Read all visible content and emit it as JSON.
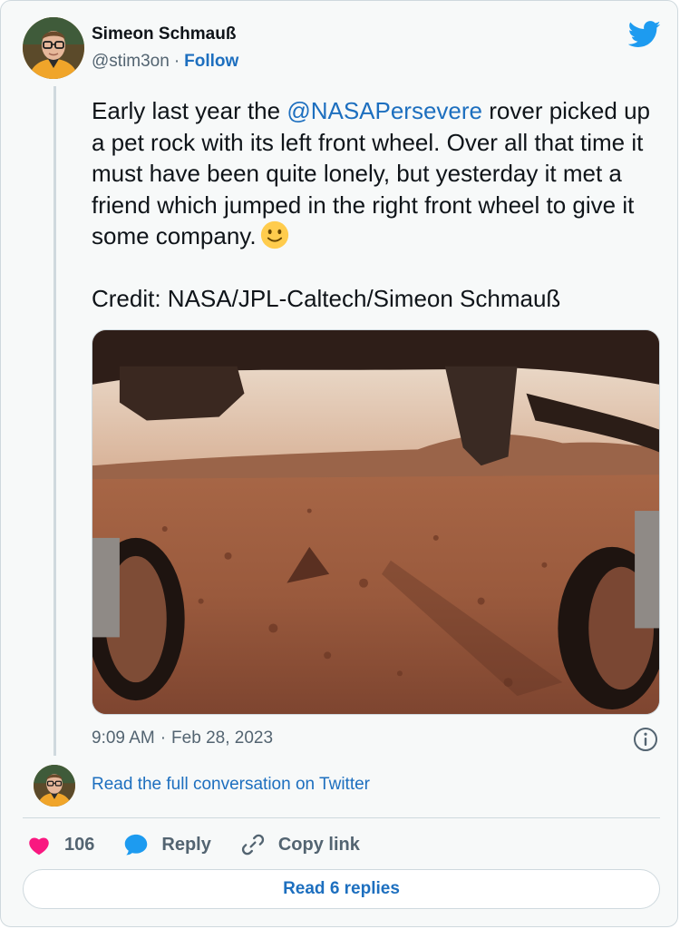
{
  "author": {
    "display_name": "Simeon Schmauß",
    "handle": "@stim3on",
    "separator": "·",
    "follow_label": "Follow"
  },
  "tweet": {
    "text_before_mention": "Early last year the ",
    "mention": "@NASAPersevere",
    "text_after_mention": " rover picked up a pet rock with its left front wheel. Over all that time it must have been quite lonely, but yesterday it met a friend which jumped in the right front wheel to give it some company.",
    "emoji": "slightly-smiling-face",
    "credit": "Credit: NASA/JPL-Caltech/Simeon Schmauß"
  },
  "meta": {
    "time": "9:09 AM",
    "separator": "·",
    "date": "Feb 28, 2023"
  },
  "conversation": {
    "read_full_label": "Read the full conversation on Twitter"
  },
  "actions": {
    "like_count": "106",
    "reply_label": "Reply",
    "copy_link_label": "Copy link"
  },
  "replies_button_label": "Read 6 replies",
  "icons": {
    "brand": "twitter-bird-icon",
    "info": "info-icon",
    "like": "heart-icon",
    "reply": "speech-bubble-icon",
    "copy": "link-icon"
  },
  "colors": {
    "link": "#1d6fbf",
    "twitter_blue": "#1d9bf0",
    "heart": "#f91880",
    "muted_text": "#536471",
    "border": "#cfd9de"
  }
}
